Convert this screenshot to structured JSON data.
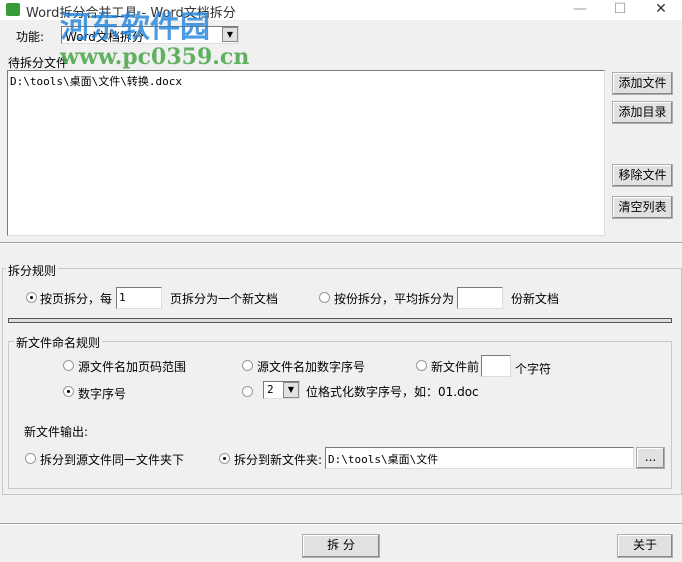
{
  "window": {
    "title": "Word拆分合并工具 - Word文档拆分",
    "minimize": "—",
    "maximize": "☐",
    "close": "✕"
  },
  "function": {
    "label": "功能:",
    "value": "Word文档拆分"
  },
  "files": {
    "label": "待拆分文件",
    "items": [
      "D:\\tools\\桌面\\文件\\转换.docx"
    ]
  },
  "side_buttons": {
    "add_file": "添加文件",
    "add_dir": "添加目录",
    "remove_file": "移除文件",
    "clear_list": "清空列表"
  },
  "split_rule": {
    "title": "拆分规则",
    "by_page_label": "按页拆分，每",
    "pages_value": "1",
    "by_page_suffix": "页拆分为一个新文档",
    "by_count_label": "按份拆分，平均拆分为",
    "count_value": "",
    "by_count_suffix": "份新文档",
    "selected": "by_page"
  },
  "naming": {
    "title": "新文件命名规则",
    "opt_page_range": "源文件名加页码范围",
    "opt_source_number": "源文件名加数字序号",
    "opt_prefix_label": "新文件前",
    "prefix_value": "",
    "opt_prefix_suffix": "个字符",
    "opt_number": "数字序号",
    "digits_value": "2",
    "opt_formatted_suffix": "位格式化数字序号，如：01.doc",
    "selected": "number"
  },
  "output": {
    "title": "新文件输出:",
    "opt_same_folder": "拆分到源文件同一文件夹下",
    "opt_new_folder": "拆分到新文件夹:",
    "folder_value": "D:\\tools\\桌面\\文件",
    "browse": "...",
    "selected": "new_folder"
  },
  "footer": {
    "split": "拆 分",
    "about": "关于"
  },
  "watermark": {
    "name": "河东软件园",
    "url": "www.pc0359.cn"
  }
}
